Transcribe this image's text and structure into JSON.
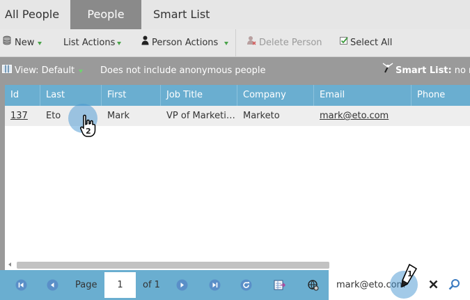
{
  "tabs": [
    {
      "label": "All People"
    },
    {
      "label": "People"
    },
    {
      "label": "Smart List"
    }
  ],
  "toolbar": {
    "new_label": "New",
    "list_actions_label": "List Actions",
    "person_actions_label": "Person Actions",
    "delete_person_label": "Delete Person",
    "select_all_label": "Select All"
  },
  "viewbar": {
    "view_label": "View: Default",
    "anonymous_note": "Does not include anonymous people",
    "smart_list_label": "Smart List:",
    "smart_list_value": "no rul"
  },
  "grid": {
    "columns": [
      "Id",
      "Last",
      "First",
      "Job Title",
      "Company",
      "Email",
      "Phone"
    ],
    "rows": [
      {
        "id": "137",
        "last": "Eto",
        "first": "Mark",
        "job_title": "VP of Marketing",
        "company": "Marketo",
        "email": "mark@eto.com",
        "phone": ""
      }
    ]
  },
  "pager": {
    "page_label": "Page",
    "page_value": "1",
    "of_label": "of 1",
    "search_value": "mark@eto.com"
  },
  "annotations": {
    "step1": "1",
    "step2": "2"
  },
  "colors": {
    "header_blue": "#6aaed0",
    "view_bar_gray": "#9a9a9a",
    "active_tab_gray": "#8a8a8a"
  }
}
